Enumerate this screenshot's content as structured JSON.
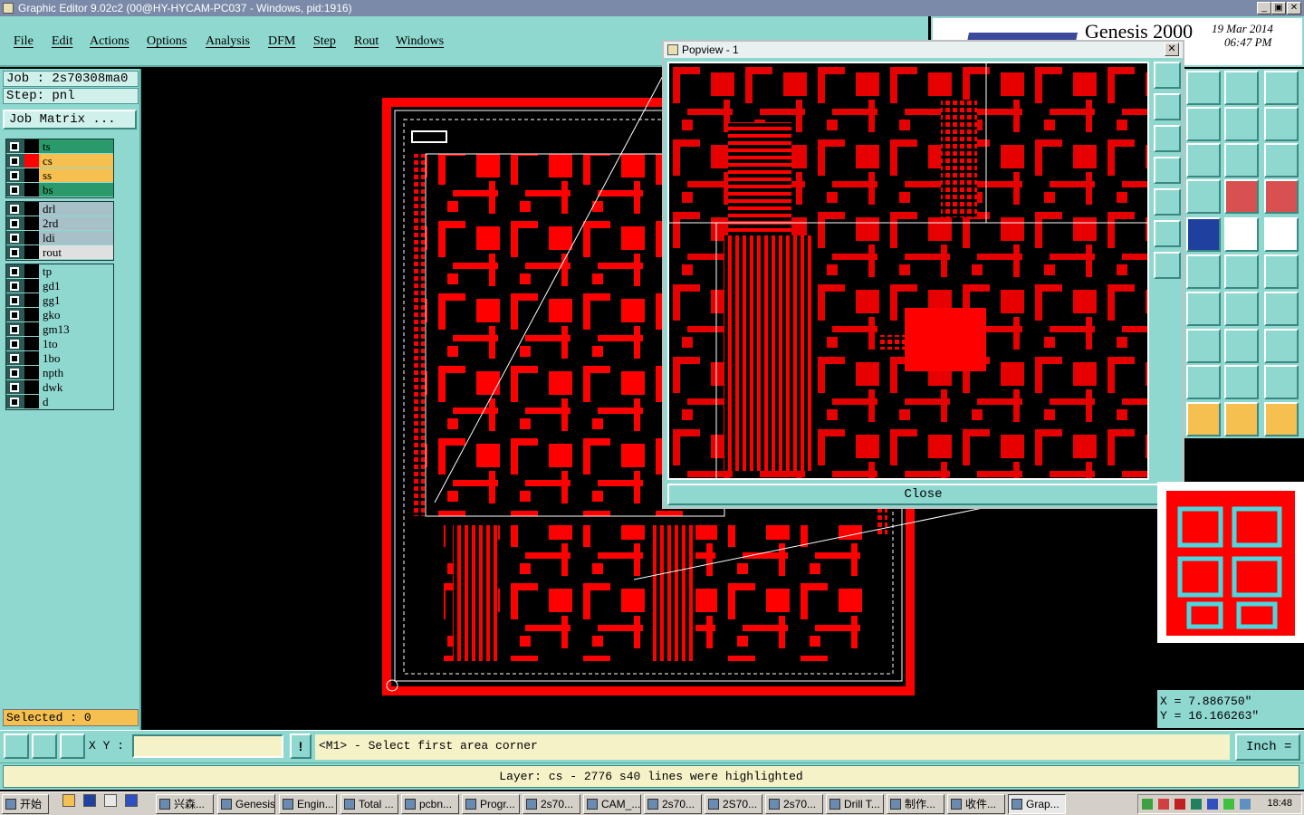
{
  "window": {
    "title": "Graphic Editor 9.02c2 (00@HY-HYCAM-PC037 - Windows, pid:1916)",
    "min": "_",
    "max": "▣",
    "close": "✕"
  },
  "menu": [
    {
      "label": "File"
    },
    {
      "label": "Edit"
    },
    {
      "label": "Actions"
    },
    {
      "label": "Options"
    },
    {
      "label": "Analysis"
    },
    {
      "label": "DFM"
    },
    {
      "label": "Step"
    },
    {
      "label": "Rout"
    },
    {
      "label": "Windows"
    }
  ],
  "logo": {
    "name": "Genesis 2000",
    "date": "19 Mar 2014",
    "time": "06:47 PM",
    "colors": {
      "brand": "#1a2a8a",
      "accent": "#d82020"
    }
  },
  "job": {
    "job_line": "Job : 2s70308ma0",
    "step_line": "Step: pnl",
    "matrix_btn": "Job Matrix ..."
  },
  "layers": {
    "board": [
      {
        "name": "ts",
        "color": "#2a9a6a",
        "swatch": "#000"
      },
      {
        "name": "cs",
        "color": "#f5c050",
        "swatch": "#ff0000",
        "active": true
      },
      {
        "name": "ss",
        "color": "#f5c050",
        "swatch": "#000"
      },
      {
        "name": "bs",
        "color": "#2a9a6a",
        "swatch": "#000"
      }
    ],
    "drill": [
      {
        "name": "drl",
        "color": "#a8c0c8",
        "swatch": "#000"
      },
      {
        "name": "2rd",
        "color": "#a8c0c8",
        "swatch": "#000"
      },
      {
        "name": "ldi",
        "color": "#a8c0c8",
        "swatch": "#000"
      },
      {
        "name": "rout",
        "color": "#e0e0e0",
        "swatch": "#000"
      }
    ],
    "misc": [
      {
        "name": "tp"
      },
      {
        "name": "gd1"
      },
      {
        "name": "gg1"
      },
      {
        "name": "gko"
      },
      {
        "name": "gm13"
      },
      {
        "name": "1to"
      },
      {
        "name": "1bo"
      },
      {
        "name": "npth"
      },
      {
        "name": "dwk"
      },
      {
        "name": "d"
      }
    ]
  },
  "selected": "Selected : 0",
  "popview": {
    "title": "Popview - 1",
    "close_label": "Close",
    "close_x": "✕"
  },
  "coords": {
    "x": "X = 7.886750\"",
    "y": "Y = 16.166263\""
  },
  "input": {
    "xy_label": "X Y :",
    "xy_value": "",
    "excl": "!",
    "prompt": "<M1> - Select first area corner",
    "units": "Inch ="
  },
  "status": "Layer: cs - 2776 s40 lines were highlighted",
  "taskbar": {
    "start": "开始",
    "tasks": [
      "兴森...",
      "Genesis",
      "Engin...",
      "Total ...",
      "pcbn...",
      "Progr...",
      "2s70...",
      "CAM_...",
      "2s70...",
      "2S70...",
      "2s70...",
      "Drill T...",
      "制作...",
      "收件...",
      "Grap..."
    ],
    "clock": "18:48"
  }
}
